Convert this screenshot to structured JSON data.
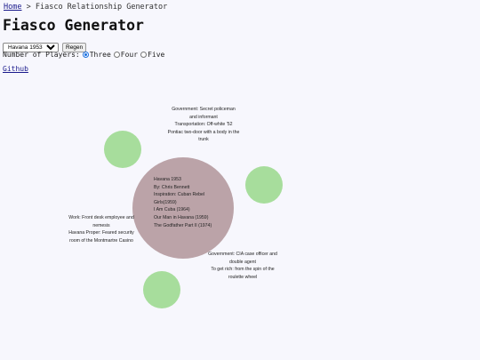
{
  "breadcrumb": {
    "home": "Home",
    "separator": ">",
    "current": "Fiasco Relationship Generator"
  },
  "title": "Fiasco Generator",
  "controls": {
    "playset_selected": "Havana 1953",
    "regen_label": "Regen",
    "players_label": "Number of Players:",
    "player_options": [
      "Three",
      "Four",
      "Five"
    ],
    "player_selected": "Three"
  },
  "github_link": "Github",
  "colors": {
    "playset": "#bba3a8",
    "player": "#a7dd9c",
    "background": "#f7f7fd",
    "link": "#1a1a8c"
  },
  "playset_info": {
    "name": "Havana 1953",
    "author": "By: Chris Bennett",
    "inspiration_lines": [
      "Inspiration: Cuban Rebel",
      "Girls(1959)",
      "I Am Cuba (1964)",
      "Our Man in Havana (1959)",
      "The Godfather Part II (1974)"
    ]
  },
  "relationships": {
    "top": [
      "Government: Secret policeman",
      "and informant",
      "Transportation: Off-white '52",
      "Pontiac two-door with a body in the",
      "trunk"
    ],
    "left": [
      "Work: Front desk employee and",
      "nemesis",
      "Havana Proper: Feared security",
      "room of the Montmartre Casino"
    ],
    "right": [
      "Government: CIA case officer and",
      "double agent",
      "To get rich: from the spin of the",
      "roulette wheel"
    ]
  }
}
